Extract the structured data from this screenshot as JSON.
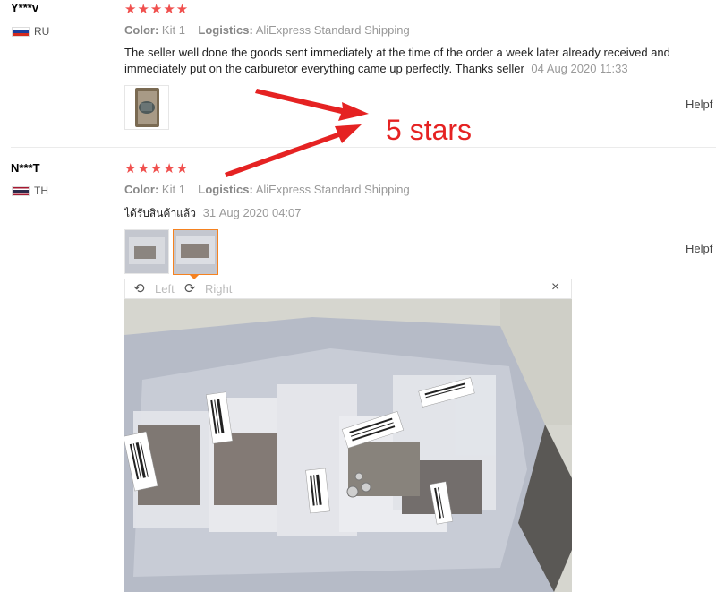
{
  "reviews": [
    {
      "user": "Y***v",
      "country": "RU",
      "stars": "★★★★★",
      "color_label": "Color:",
      "color_value": "Kit 1",
      "logistics_label": "Logistics:",
      "logistics_value": "AliExpress Standard Shipping",
      "feedback_line1": "The seller well done the goods sent immediately at the time of the order a week later already received and",
      "feedback_line2": "immediately put on the carburetor everything came up perfectly. Thanks seller",
      "date": "04 Aug 2020 11:33",
      "helpful": "Helpf"
    },
    {
      "user": "N***T",
      "country": "TH",
      "stars": "★★★★★",
      "color_label": "Color:",
      "color_value": "Kit 1",
      "logistics_label": "Logistics:",
      "logistics_value": "AliExpress Standard Shipping",
      "feedback": "ได้รับสินค้าแล้ว",
      "date": "31 Aug 2020 04:07",
      "helpful": "Helpf"
    }
  ],
  "annotation": {
    "text": "5 stars",
    "color": "#e52222"
  },
  "viewer": {
    "rotate_left": "Left",
    "rotate_right": "Right",
    "close": "×"
  },
  "colors": {
    "stars": "#f0504e",
    "accent": "#f58220"
  },
  "icons": [
    "rotate-left-icon",
    "rotate-right-icon",
    "close-icon"
  ]
}
